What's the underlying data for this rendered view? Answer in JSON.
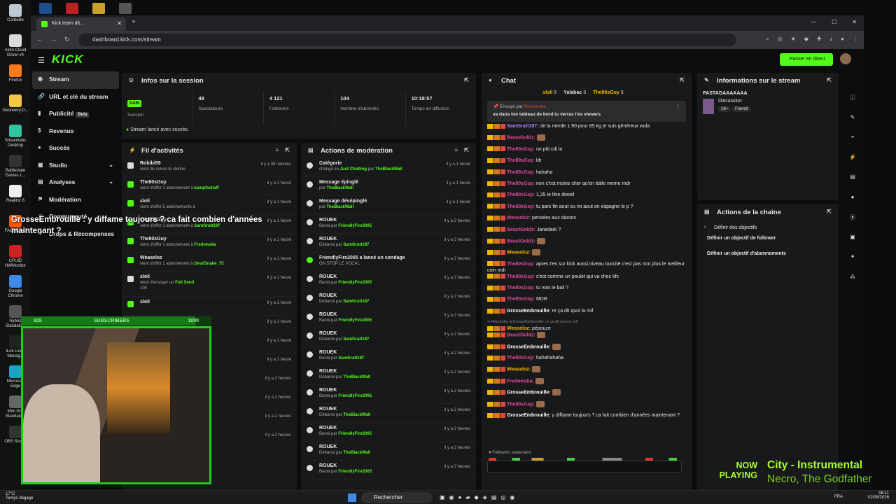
{
  "desktop": {
    "icons": [
      {
        "label": "Corbeille",
        "color": "#bfc7d5"
      },
      {
        "label": "Akko Cloud Driver v4",
        "color": "#d9d9d9"
      },
      {
        "label": "Firefox",
        "color": "#ff7a1a"
      },
      {
        "label": "Geometry.D...",
        "color": "#f3c84b"
      },
      {
        "label": "Streamlabs Desktop",
        "color": "#31c3a2"
      },
      {
        "label": "Battlestate Games L...",
        "color": "#333"
      },
      {
        "label": "Reaktor 6",
        "color": "#eee"
      },
      {
        "label": "FACEIT AC",
        "color": "#ff5500"
      },
      {
        "label": "CPUID HWMonitor",
        "color": "#cc2222"
      },
      {
        "label": "Google Chrome",
        "color": "#3c8bea"
      },
      {
        "label": "Hybrid Standalo...",
        "color": "#555"
      },
      {
        "label": "iLok Licen Manag...",
        "color": "#222"
      },
      {
        "label": "Microsoft Edge",
        "color": "#1da1c7"
      },
      {
        "label": "Mini Gra Standalo...",
        "color": "#666"
      },
      {
        "label": "OBS Studio",
        "color": "#333"
      }
    ]
  },
  "browser": {
    "tab_title": "Kick team dit...",
    "url": "dashboard.kick.com/stream"
  },
  "kick": {
    "logo": "KICK",
    "go_live": "Passer en direct",
    "sidebar": [
      {
        "label": "Stream",
        "icon": "◉",
        "active": true
      },
      {
        "label": "URL et clé du stream",
        "icon": "🔗"
      },
      {
        "label": "Publicité",
        "icon": "▮",
        "badge": "Beta"
      },
      {
        "label": "Revenus",
        "icon": "$"
      },
      {
        "label": "Succès",
        "icon": "●"
      },
      {
        "label": "Studio",
        "icon": "▣",
        "chev": "⌄"
      },
      {
        "label": "Analyses",
        "icon": "▤",
        "chev": "⌄"
      },
      {
        "label": "Modération",
        "icon": "⚑"
      },
      {
        "label": "Communauté",
        "icon": "☺"
      },
      {
        "label": "Drops & Récompenses",
        "icon": "✦"
      }
    ],
    "session": {
      "title": "Infos sur la session",
      "badge": "SAIN",
      "session_label": "Session",
      "stats": [
        {
          "value": "48",
          "label": "Spectateurs"
        },
        {
          "value": "4 121",
          "label": "Followers"
        },
        {
          "value": "104",
          "label": "Nombre d'abonnés"
        },
        {
          "value": "10:18:57",
          "label": "Temps en diffusion"
        }
      ],
      "status": "Stream lancé avec succès."
    },
    "activity": {
      "title": "Fil d'activités",
      "items": [
        {
          "name": "Robibi59",
          "desc": "vient de suivre la chaîne",
          "who": "",
          "time": "il y a 36 minutes",
          "color": "#ddd"
        },
        {
          "name": "The80sGuy",
          "desc": "vient d'offrir 1 abonnement à",
          "who": "kampfschaff",
          "time": "il y a 1 heure",
          "color": "#53fc18"
        },
        {
          "name": "sloli",
          "desc": "vient d'offrir 5 abonnements à",
          "who": "",
          "time": "il y a 1 heure",
          "color": "#53fc18"
        },
        {
          "name": "The80sGuy",
          "desc": "vient d'offrir 1 abonnement à",
          "who": "SamGratt187",
          "time": "il y a 1 heure",
          "color": "#53fc18"
        },
        {
          "name": "The80sGuy",
          "desc": "vient d'offrir 1 abonnement à",
          "who": "Fredowska",
          "time": "il y a 1 heure",
          "color": "#53fc18"
        },
        {
          "name": "Weaseloz",
          "desc": "vient d'offrir 1 abonnement à",
          "who": "DevilSnake_75",
          "time": "il y a 1 heure",
          "color": "#53fc18"
        },
        {
          "name": "sloli",
          "desc": "vient d'envoyer un",
          "who": "Full Send",
          "time": "il y a 1 heure",
          "color": "#ddd",
          "extra": "100"
        },
        {
          "name": "sloli",
          "desc": "",
          "who": "",
          "time": "il y a 1 heure",
          "color": "#53fc18"
        }
      ],
      "tail_times": [
        "il y a 1 heure",
        "il y a 1 heure",
        "il y a 1 heure",
        "il y a 2 heures",
        "il y a 2 heures",
        "il y a 2 heures",
        "il y a 2 heures"
      ],
      "partial_name": "moister"
    },
    "moderation": {
      "title": "Actions de modération",
      "items": [
        {
          "t1": "Catégorie",
          "t2a": "changé en",
          "t2g": "Just Chatting",
          "t2b": "par",
          "t2c": "TheBlackWall",
          "time": "il y a 1 heure",
          "ic": "#ddd"
        },
        {
          "t1": "Message épinglé",
          "t2a": "par",
          "t2g": "",
          "t2b": "",
          "t2c": "TheBlackWall",
          "time": "il y a 1 heure",
          "ic": "#ddd"
        },
        {
          "t1": "Message désépinglé",
          "t2a": "par",
          "t2g": "",
          "t2b": "",
          "t2c": "TheBlackWall",
          "time": "il y a 1 heure",
          "ic": "#ddd"
        },
        {
          "t1": "ROUEK",
          "t2a": "Banni par",
          "t2g": "",
          "t2b": "",
          "t2c": "FriendlyFire2005",
          "time": "il y a 2 heures",
          "ic": "#ddd"
        },
        {
          "t1": "ROUEK",
          "t2a": "Débanni par",
          "t2g": "",
          "t2b": "",
          "t2c": "SamGratt187",
          "time": "il y a 2 heures",
          "ic": "#ddd"
        },
        {
          "t1": "FriendlyFire2005 a lancé un sondage",
          "t2a": "ON STOP LE VOCAL",
          "t2g": "",
          "t2b": "",
          "t2c": "",
          "time": "il y a 2 heures",
          "ic": "#53fc18"
        },
        {
          "t1": "ROUEK",
          "t2a": "Banni par",
          "t2g": "",
          "t2b": "",
          "t2c": "FriendlyFire2005",
          "time": "il y a 2 heures",
          "ic": "#ddd"
        },
        {
          "t1": "ROUEK",
          "t2a": "Débanni par",
          "t2g": "",
          "t2b": "",
          "t2c": "SamGratt187",
          "time": "il y a 2 heures",
          "ic": "#ddd"
        },
        {
          "t1": "ROUEK",
          "t2a": "Banni par",
          "t2g": "",
          "t2b": "",
          "t2c": "FriendlyFire2005",
          "time": "il y a 2 heures",
          "ic": "#ddd"
        },
        {
          "t1": "ROUEK",
          "t2a": "Débanni par",
          "t2g": "",
          "t2b": "",
          "t2c": "SamGratt187",
          "time": "il y a 2 heures",
          "ic": "#ddd"
        },
        {
          "t1": "ROUEK",
          "t2a": "Banni par",
          "t2g": "",
          "t2b": "",
          "t2c": "SamGratt187",
          "time": "il y a 2 heures",
          "ic": "#ddd"
        },
        {
          "t1": "ROUEK",
          "t2a": "Débanni par",
          "t2g": "",
          "t2b": "",
          "t2c": "TheBlackWall",
          "time": "il y a 2 heures",
          "ic": "#ddd"
        },
        {
          "t1": "ROUEK",
          "t2a": "Banni par",
          "t2g": "",
          "t2b": "",
          "t2c": "FriendlyFire2005",
          "time": "il y a 2 heures",
          "ic": "#ddd"
        },
        {
          "t1": "ROUEK",
          "t2a": "Débanni par",
          "t2g": "",
          "t2b": "",
          "t2c": "TheBlackWall",
          "time": "il y a 2 heures",
          "ic": "#ddd"
        },
        {
          "t1": "ROUEK",
          "t2a": "Banni par",
          "t2g": "",
          "t2b": "",
          "t2c": "FriendlyFire2005",
          "time": "il y a 2 heures",
          "ic": "#ddd"
        },
        {
          "t1": "ROUEK",
          "t2a": "Débanni par",
          "t2g": "",
          "t2b": "",
          "t2c": "TheBlackWall",
          "time": "il y a 2 heures",
          "ic": "#ddd"
        },
        {
          "t1": "ROUEK",
          "t2a": "Banni par",
          "t2g": "",
          "t2b": "",
          "t2c": "FriendlyFire2005",
          "time": "il y a 2 heures",
          "ic": "#ddd"
        }
      ]
    },
    "chat": {
      "title": "Chat",
      "top_gifters": [
        {
          "name": "sloli",
          "count": "5",
          "color": "#f2b705"
        },
        {
          "name": "Yalabac",
          "count": "3",
          "color": "#dddddd"
        },
        {
          "name": "The80sGuy",
          "count": "3",
          "color": "#f2b705"
        }
      ],
      "pinned": {
        "sent_by": "Envoyé par",
        "author": "Rouxmoux",
        "text": "va dans ton tableau de bord tu verras t'es viewers"
      },
      "messages": [
        {
          "user": "SamGratt187",
          "color": "#b37feb",
          "text": "de la merde 1.90 pour 85 kg je suis généreux wola"
        },
        {
          "user": "BeastGoldz",
          "color": "#e04a9a",
          "text": "",
          "emote": true
        },
        {
          "user": "The80sGuy",
          "color": "#e04a9a",
          "text": "un ptit cdi la"
        },
        {
          "user": "The80sGuy",
          "color": "#e04a9a",
          "text": "ldr"
        },
        {
          "user": "The80sGuy",
          "color": "#e04a9a",
          "text": "hahaha"
        },
        {
          "user": "The80sGuy",
          "color": "#e04a9a",
          "text": "non c'est moins cher qu'en italie meme mdr"
        },
        {
          "user": "The80sGuy",
          "color": "#e04a9a",
          "text": "1,35 le litre diesel"
        },
        {
          "user": "The80sGuy",
          "color": "#e04a9a",
          "text": "tu pars fin aout ou mi aout en espagne le p ?"
        },
        {
          "user": "Weaseloz",
          "color": "#e04a9a",
          "text": "pensées aux darons"
        },
        {
          "user": "BeastGoldz",
          "color": "#e04a9a",
          "text": "Janedark ?"
        },
        {
          "user": "BeastGoldz",
          "color": "#e04a9a",
          "text": "",
          "emote": true
        },
        {
          "user": "Weaseloz",
          "color": "#f2b705",
          "text": "",
          "emote": true
        },
        {
          "user": "The80sGuy",
          "color": "#e04a9a",
          "text": "apres t'es sur kick aussi niveau toxicité c'est pas non plus le meilleur coin mdr",
          "tall": true
        },
        {
          "user": "The80sGuy",
          "color": "#e04a9a",
          "text": "c'est comme un poulet qui va chez kfc"
        },
        {
          "user": "The80sGuy",
          "color": "#e04a9a",
          "text": "tu vois le bail ?"
        },
        {
          "user": "The80sGuy",
          "color": "#e04a9a",
          "text": "MDR"
        },
        {
          "user": "GrosseEmbrouille",
          "color": "#ffffff",
          "text": "re ça dit quoi la mif"
        },
        {
          "reply": "Répondre à GrosseEmbrouille: re ça dit quoi la mif",
          "user": "Weaseloz",
          "color": "#f2b705",
          "text": "pépouze"
        },
        {
          "user": "BeastGoldz",
          "color": "#e04a9a",
          "text": "",
          "emote": true
        },
        {
          "user": "GrosseEmbrouille",
          "color": "#ffffff",
          "text": "",
          "emote": true
        },
        {
          "user": "The80sGuy",
          "color": "#e04a9a",
          "text": "hahahahaha"
        },
        {
          "user": "Weaseloz",
          "color": "#f2b705",
          "text": "",
          "emote": true
        },
        {
          "user": "Fredowska",
          "color": "#e04a9a",
          "text": "",
          "emote": true
        },
        {
          "user": "GrosseEmbrouille",
          "color": "#ffffff",
          "text": "",
          "emote": true
        },
        {
          "user": "The80sGuy",
          "color": "#e04a9a",
          "text": "",
          "emote": true
        },
        {
          "user": "GrosseEmbrouille",
          "color": "#ffffff",
          "text": "y diffame toujours ? ca fait combien d'années maintenant ?",
          "tall": true
        }
      ],
      "followers_only": "Followers seulement"
    },
    "stream_info": {
      "title": "Informations sur le stream",
      "stream_title": "PASTAGAAAAAAA",
      "category": "Discussion",
      "tags": [
        "18+",
        "French"
      ]
    },
    "channel_actions": {
      "title": "Actions de la chaîne",
      "back": "Définir des objectifs",
      "items": [
        "Définir un objectif de follower",
        "Définir un objectif d'abonnements"
      ]
    }
  },
  "overlay": {
    "chat_line": "GrosseEmbrouille : y diffame toujours ? ca fait combien d'années maintenant ?",
    "goal": {
      "current": "915",
      "label": "SUBSCRIBERS",
      "target": "1000",
      "fraction": 0.915
    },
    "now_playing_label": "NOW PLAYING",
    "track": "City - Instrumental",
    "artist": "Necro, The Godfather"
  },
  "taskbar": {
    "weather": "17°C",
    "weather_desc": "Temps dégagé",
    "search": "Rechercher",
    "lang": "FRA",
    "time": "06:11",
    "date": "02/08/2026"
  }
}
